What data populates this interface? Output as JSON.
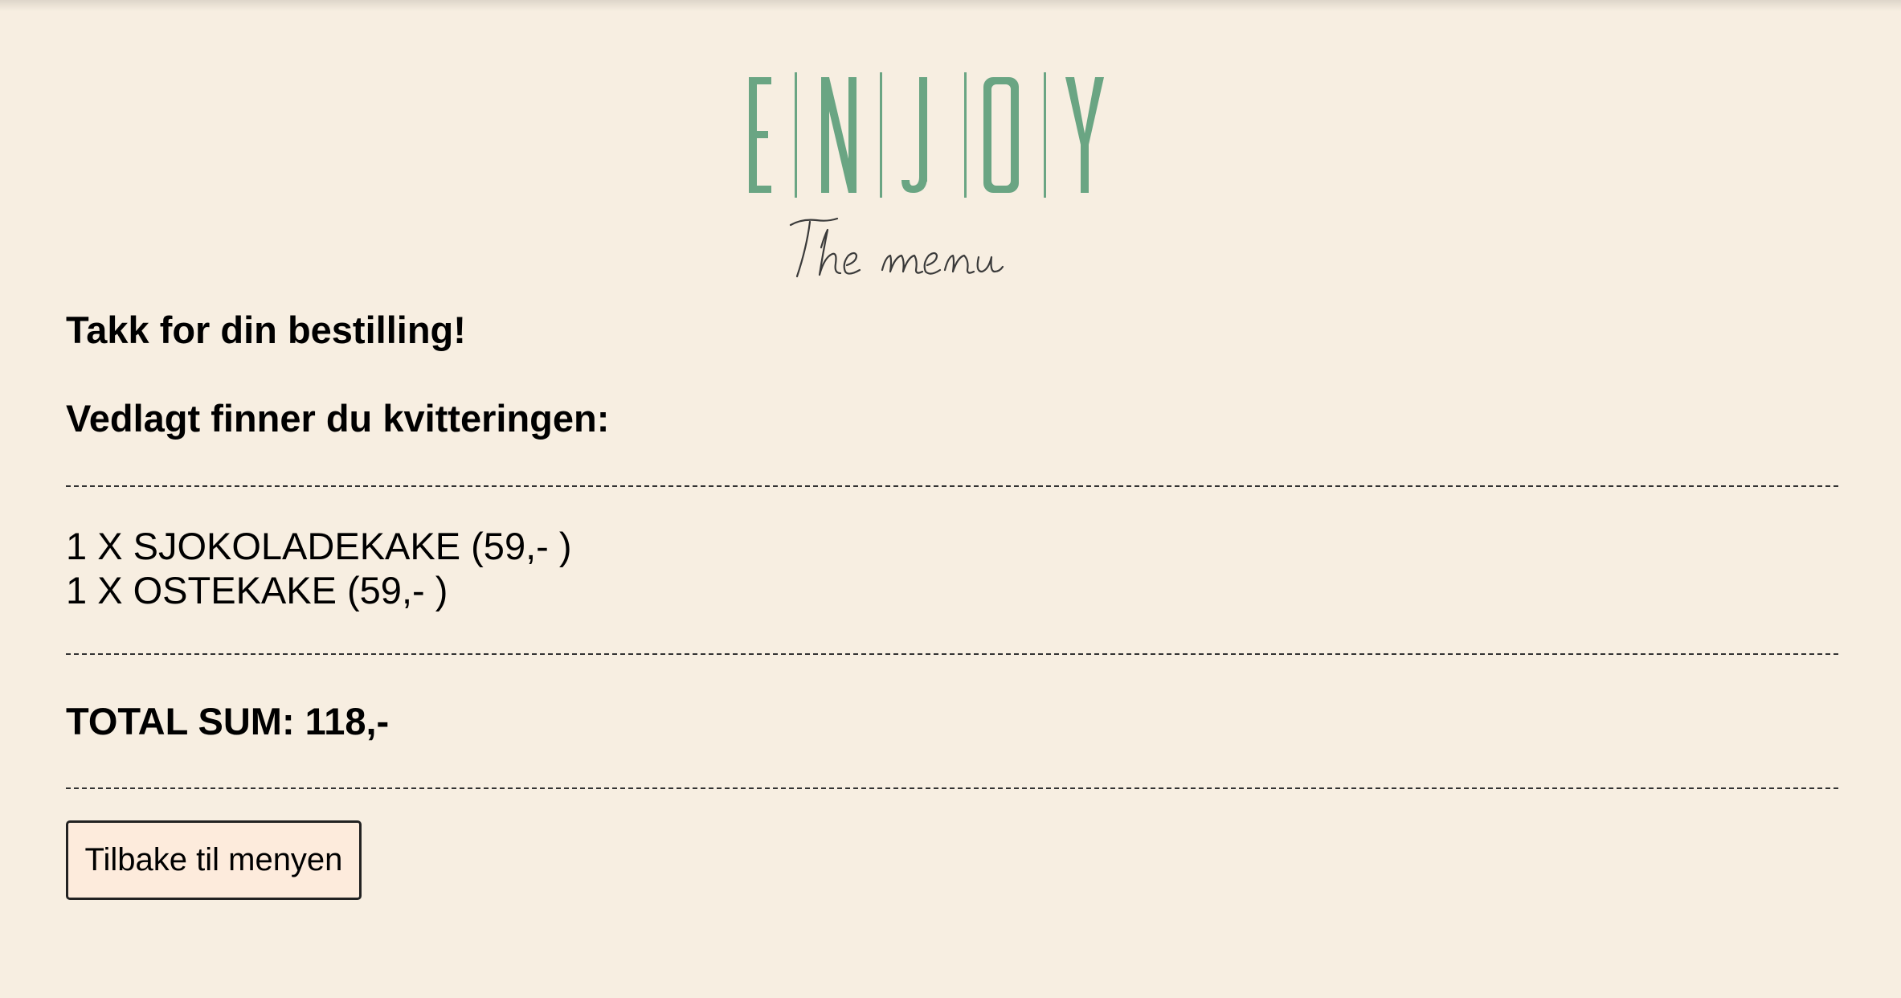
{
  "logo": {
    "wordmark": "ENJOY",
    "tagline": "The menu",
    "color": "#6aa583"
  },
  "page": {
    "background": "#f7eee1"
  },
  "confirmation": {
    "thanks": "Takk for din bestilling!",
    "receipt_intro": "Vedlagt finner du kvitteringen:"
  },
  "order": {
    "items": [
      "1 X SJOKOLADEKAKE (59,- )",
      "1 X OSTEKAKE (59,- )"
    ],
    "total": "TOTAL SUM: 118,-"
  },
  "actions": {
    "back_label": "Tilbake til menyen"
  }
}
